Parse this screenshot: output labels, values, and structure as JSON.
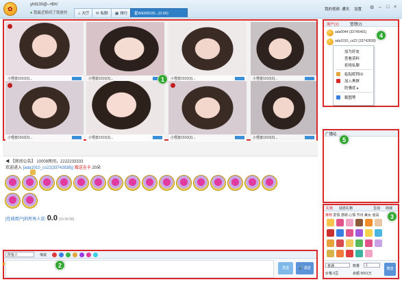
{
  "header": {
    "username": "yhll100@--•$%'",
    "status": "我最近郁闷了我是的",
    "tabs": [
      {
        "label": "大厅"
      },
      {
        "label": "私聊"
      },
      {
        "label": "排行"
      },
      {
        "label": "星WER8100...(0-00)"
      }
    ],
    "menu": [
      "我的视频",
      "通讯",
      "设置"
    ]
  },
  "video_panel": {
    "badge": "1",
    "tiles": [
      {
        "caption": "小怪兽1010(3)..."
      },
      {
        "caption": "小怪兽1010(3)..."
      },
      {
        "caption": "小怪兽1010(3)..."
      },
      {
        "caption": "小怪兽1010(3)..."
      },
      {
        "caption": "小怪兽1010(3)..."
      },
      {
        "caption": "小怪兽1010(3)..."
      },
      {
        "caption": "小怪兽1010(3)..."
      },
      {
        "caption": "小怪兽1010(3)..."
      }
    ]
  },
  "chat": {
    "announcement": "【房间公告】 10009房间，2222233333",
    "welcome_prefix": "欢迎进入",
    "welcome_user": "[ada1010_cs22(33742838)]",
    "welcome_gift": "赠送吉卡",
    "welcome_count": "20朵",
    "total_label": "[在线用户]的所有人说:",
    "total_value": "0.0",
    "timestamp": "(15:36:58)"
  },
  "input_panel": {
    "badge": "2",
    "target": "所有人",
    "label": "悄说",
    "send_label": "发送",
    "voice_label": "语音"
  },
  "user_panel": {
    "badge": "4",
    "tabs": [
      "用户(2)",
      "管理(2)"
    ],
    "users": [
      {
        "name": "ada0044 (33745481)"
      },
      {
        "name": "ada1010_cs22 (33742838)"
      }
    ],
    "context_menu": [
      "加为好友",
      "查看资料",
      "拒绝私聊",
      "粘贴昵称ID",
      "加入黑屏",
      "防骚扰",
      "截图等"
    ]
  },
  "side_panel": {
    "badge": "5",
    "title": "广播站"
  },
  "gift_panel": {
    "badge": "3",
    "tabs": [
      "礼物",
      "动态礼物",
      "互动",
      "商城"
    ],
    "categories": [
      "推荐",
      "爱情",
      "感谢",
      "心情",
      "节日",
      "美女",
      "道具"
    ],
    "gift_label": "普通",
    "quantity_label": "数量",
    "quantity_value": "1",
    "balance_label": "余额",
    "balance_value": "9901万",
    "price_label": "价格",
    "price_value": "0豆",
    "send_label": "赠送"
  },
  "colors": {
    "highlight": "#d9272a",
    "badge": "#32a832",
    "accent": "#2f7fc7"
  }
}
